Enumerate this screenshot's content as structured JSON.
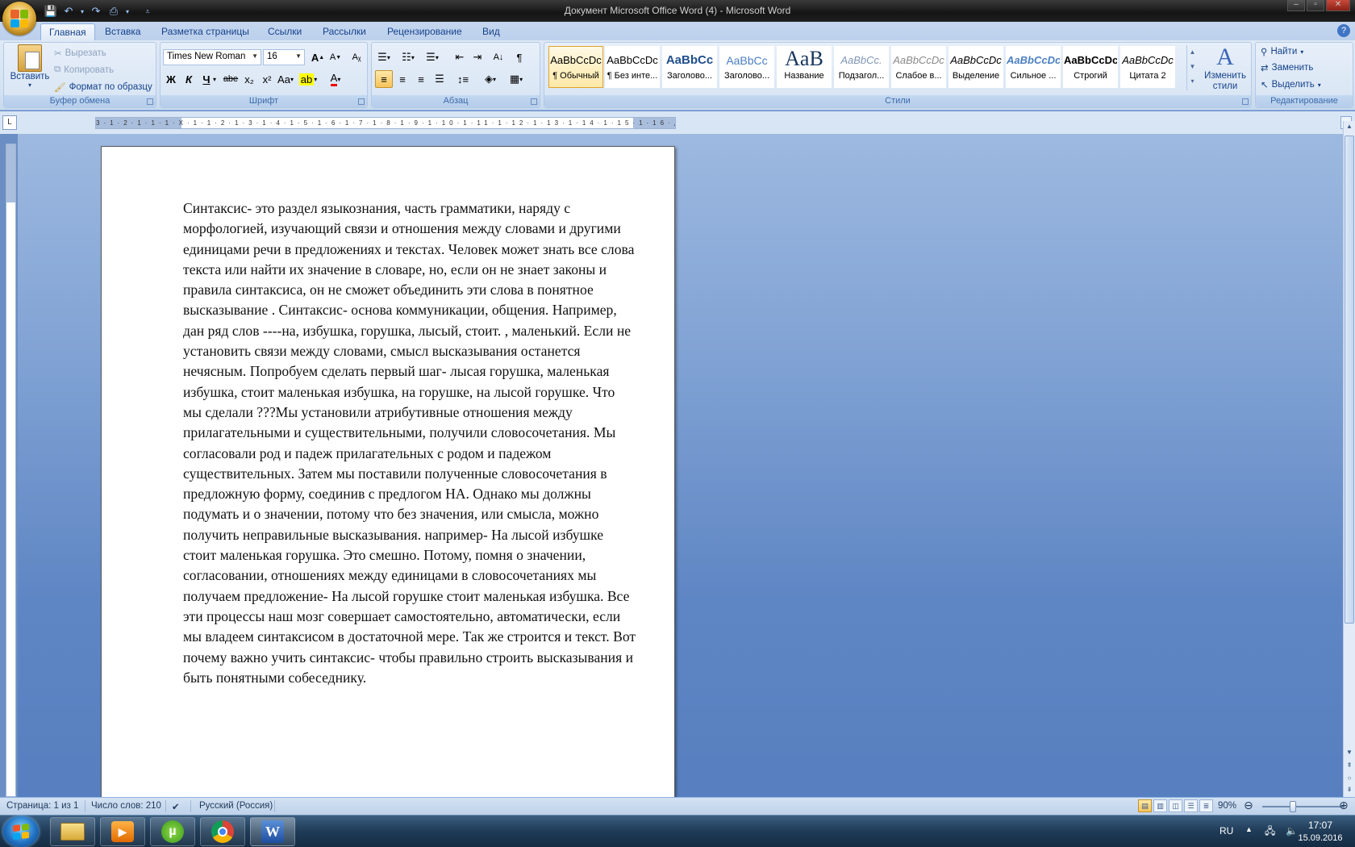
{
  "window": {
    "title": "Документ Microsoft Office Word (4)  -  Microsoft Word"
  },
  "tabs": [
    "Главная",
    "Вставка",
    "Разметка страницы",
    "Ссылки",
    "Рассылки",
    "Рецензирование",
    "Вид"
  ],
  "clipboard": {
    "paste": "Вставить",
    "cut": "Вырезать",
    "copy": "Копировать",
    "format_painter": "Формат по образцу",
    "label": "Буфер обмена"
  },
  "font": {
    "name": "Times New Roman",
    "size": "16",
    "label": "Шрифт",
    "bold": "Ж",
    "italic": "К",
    "underline": "Ч",
    "strike": "abe",
    "subscript": "x₂",
    "superscript": "x²",
    "case": "Aa",
    "grow": "A",
    "shrink": "A"
  },
  "paragraph": {
    "label": "Абзац"
  },
  "styles": {
    "label": "Стили",
    "items": [
      {
        "sample": "AaBbCcDc",
        "name": "¶ Обычный"
      },
      {
        "sample": "AaBbCcDc",
        "name": "¶ Без инте..."
      },
      {
        "sample": "AaBbCc",
        "name": "Заголово..."
      },
      {
        "sample": "AaBbCc",
        "name": "Заголово..."
      },
      {
        "sample": "AaB",
        "name": "Название"
      },
      {
        "sample": "AaBbCc.",
        "name": "Подзагол..."
      },
      {
        "sample": "AaBbCcDc",
        "name": "Слабое в..."
      },
      {
        "sample": "AaBbCcDc",
        "name": "Выделение"
      },
      {
        "sample": "AaBbCcDc",
        "name": "Сильное ..."
      },
      {
        "sample": "AaBbCcDc",
        "name": "Строгий"
      },
      {
        "sample": "AaBbCcDc",
        "name": "Цитата 2"
      }
    ],
    "change_styles": "Изменить стили"
  },
  "editing": {
    "label": "Редактирование",
    "find": "Найти",
    "replace": "Заменить",
    "select": "Выделить"
  },
  "ruler": {
    "numbers": "3·1·2·1·1·1·X·1·1·2·1·3·1·4·1·5·1·6·1·7·1·8·1·9·1·10·1·11·1·12·1·13·1·14·1·15·1·16·△·17·"
  },
  "document": {
    "text": "Синтаксис- это раздел языкознания, часть грамматики, наряду с морфологией, изучающий связи и отношения между словами и другими единицами речи в предложениях и текстах. Человек может знать все слова текста или найти их значение в словаре, но, если он не знает законы и правила синтаксиса, он не сможет объединить эти слова в понятное высказывание . Синтаксис- основа коммуникации, общения. Например, дан ряд слов ----на, избушка, горушка, лысый, стоит. , маленький. Если не установить связи между словами, смысл высказывания останется нечясным. Попробуем сделать первый шаг- лысая горушка, маленькая избушка, стоит маленькая избушка, на горушке, на лысой горушке. Что мы сделали ???Мы установили атрибутивные отношения между прилагательными и существительными, получили словосочетания. Мы согласовали род и падеж прилагательных с родом и падежом существительных. Затем мы поставили полученные словосочетания в предложную форму, соединив с предлогом НА. Однако мы должны подумать и о значении, потому что без значения, или смысла, можно получить неправильные высказывания. например- На лысой избушке стоит маленькая горушка. Это смешно. Потому, помня о значении, согласовании, отношениях между единицами в словосочетаниях мы получаем предложение- На лысой горушке стоит маленькая избушка. Все эти процессы наш мозг совершает самостоятельно, автоматически, если мы владеем синтаксисом в достаточной мере. Так же строится и текст. Вот почему важно учить синтаксис- чтобы правильно строить высказывания и быть понятными собеседнику."
  },
  "status": {
    "page": "Страница: 1 из 1",
    "words": "Число слов: 210",
    "language": "Русский (Россия)",
    "zoom": "90%"
  },
  "taskbar": {
    "lang": "RU",
    "time": "17:07",
    "date": "15.09.2016"
  },
  "colors": {
    "accent": "#15428b",
    "ribbon_bg": "#d5e2f3",
    "doc_bg": "#6b8fc4"
  }
}
